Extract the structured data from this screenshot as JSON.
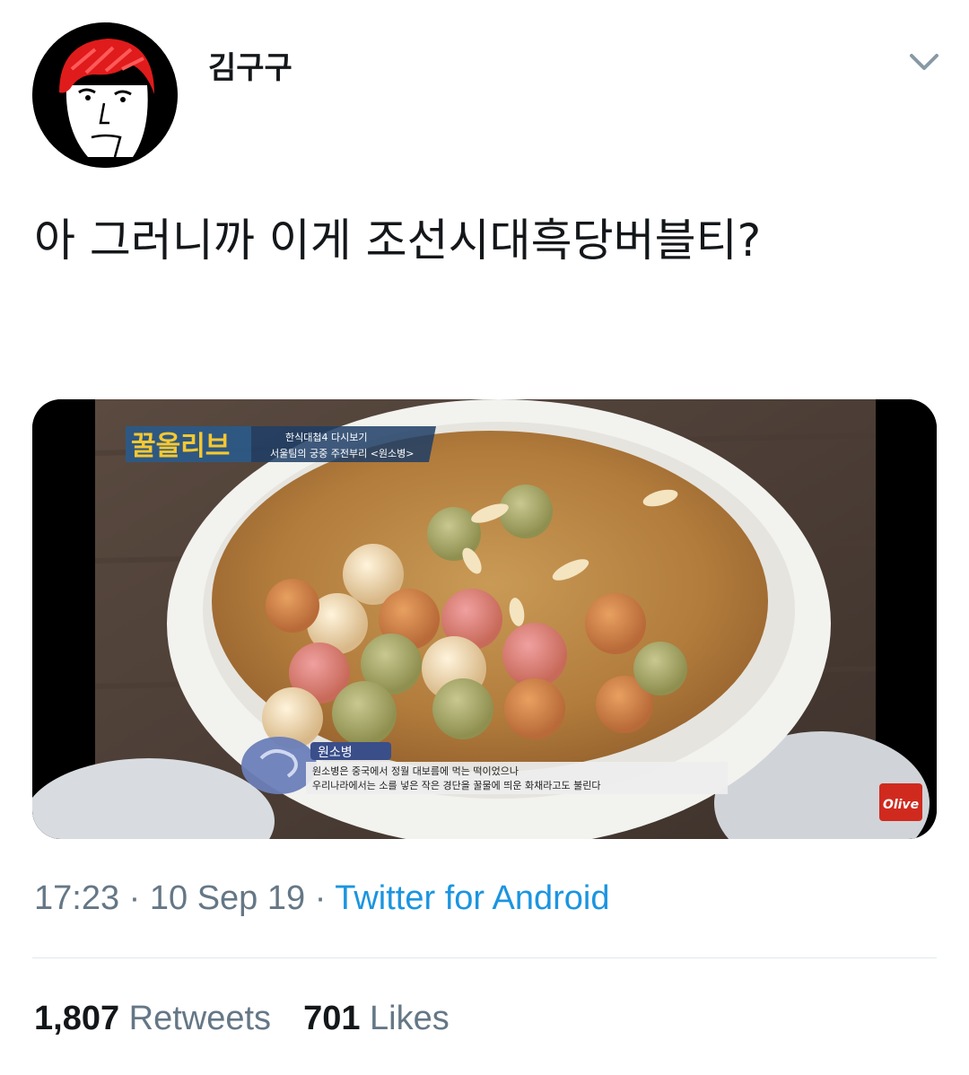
{
  "tweet": {
    "author_name": "김구구",
    "text": "아 그러니까 이게 조선시대흑당버블티?",
    "time": "17:23",
    "date": "10 Sep 19",
    "source": "Twitter for Android",
    "retweets_count": "1,807",
    "retweets_label": "Retweets",
    "likes_count": "701",
    "likes_label": "Likes",
    "separator": " · "
  },
  "media": {
    "logo_text": "꿀올리브",
    "banner_line1": "한식대첩4 다시보기",
    "banner_line2": "서울팀의 궁중 주전부리 <원소병>",
    "caption_title": "원소병",
    "caption_line1": "원소병은 중국에서 정월 대보름에 먹는 떡이었으나",
    "caption_line2": "우리나라에서는 소를 넣은 작은 경단을 꿀물에 띄운 화채라고도 불린다",
    "channel_logo": "Olive"
  },
  "icons": {
    "menu_chevron": "chevron-down-icon"
  },
  "colors": {
    "link": "#1b95e0",
    "muted": "#657786",
    "text": "#14171a"
  }
}
